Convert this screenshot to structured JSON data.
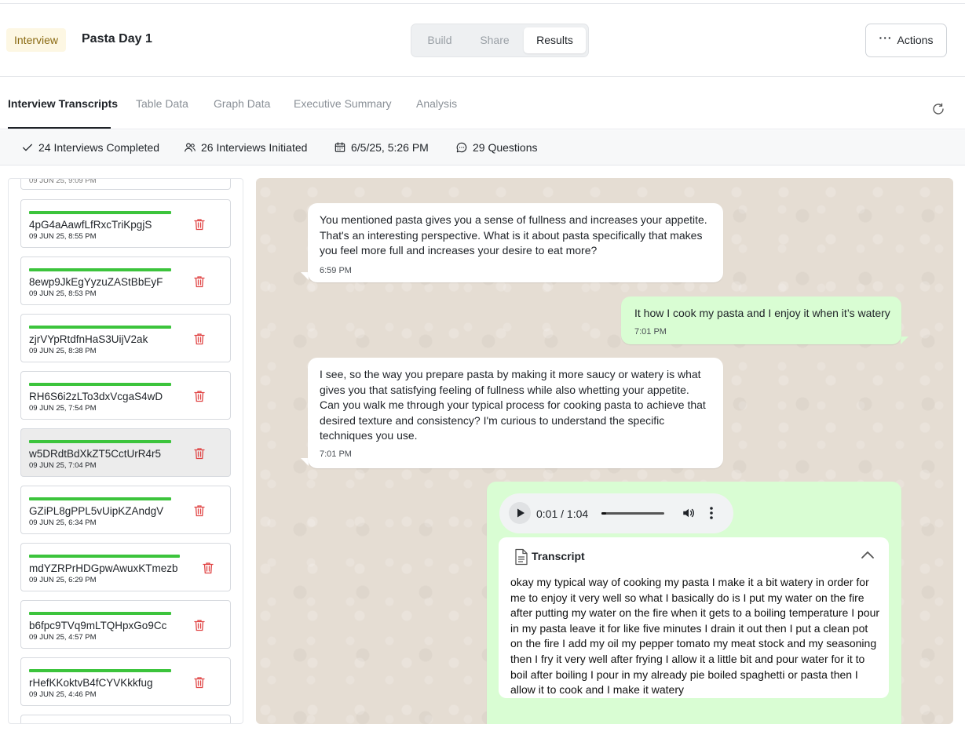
{
  "header": {
    "badge": "Interview",
    "title": "Pasta Day 1",
    "segments": [
      "Build",
      "Share",
      "Results"
    ],
    "active_segment": "Results",
    "actions_label": "Actions"
  },
  "tabs": {
    "items": [
      "Interview Transcripts",
      "Table Data",
      "Graph Data",
      "Executive Summary",
      "Analysis"
    ],
    "active": "Interview Transcripts"
  },
  "stats": {
    "completed": "24 Interviews Completed",
    "initiated": "26 Interviews Initiated",
    "date": "6/5/25, 5:26 PM",
    "questions": "29 Questions"
  },
  "interviews": [
    {
      "id": "4pG4aAawfLfRxcTriKpgjS",
      "time": "09 JUN 25, 8:55 PM",
      "selected": false
    },
    {
      "id": "8ewp9JkEgYyzuZAStBbEyF",
      "time": "09 JUN 25, 8:53 PM",
      "selected": false
    },
    {
      "id": "zjrVYpRtdfnHaS3UijV2ak",
      "time": "09 JUN 25, 8:38 PM",
      "selected": false
    },
    {
      "id": "RH6S6i2zLTo3dxVcgaS4wD",
      "time": "09 JUN 25, 7:54 PM",
      "selected": false
    },
    {
      "id": "w5DRdtBdXkZT5CctUrR4r5",
      "time": "09 JUN 25, 7:04 PM",
      "selected": true
    },
    {
      "id": "GZiPL8gPPL5vUipKZAndgV",
      "time": "09 JUN 25, 6:34 PM",
      "selected": false
    },
    {
      "id": "mdYZRPrHDGpwAwuxKTmezb",
      "time": "09 JUN 25, 6:29 PM",
      "selected": false
    },
    {
      "id": "b6fpc9TVq9mLTQHpxGo9Cc",
      "time": "09 JUN 25, 4:57 PM",
      "selected": false
    },
    {
      "id": "rHefKKoktvB4fCYVKkkfug",
      "time": "09 JUN 25, 4:46 PM",
      "selected": false
    }
  ],
  "messages": [
    {
      "role": "interviewer",
      "text": "You mentioned pasta gives you a sense of fullness and increases your appetite. That's an interesting perspective. What is it about pasta specifically that makes you feel more full and increases your desire to eat more?",
      "time": "6:59 PM"
    },
    {
      "role": "respondent",
      "text": "It how I cook my pasta and I enjoy it when it’s watery",
      "time": "7:01 PM"
    },
    {
      "role": "interviewer",
      "text": "I see, so the way you prepare pasta by making it more saucy or watery is what gives you that satisfying feeling of fullness while also whetting your appetite. Can you walk me through your typical process for cooking pasta to achieve that desired texture and consistency? I'm curious to understand the specific techniques you use.",
      "time": "7:01 PM"
    }
  ],
  "audio": {
    "time_display": "0:01 / 1:04",
    "progress": 0.016
  },
  "transcript": {
    "label": "Transcript",
    "text": " okay my typical way of cooking my pasta I make it a bit watery in order for me to enjoy it very well so what I basically do is I put my water on the fire after putting my water on the fire when it gets to a boiling temperature I pour in my pasta leave it for like five minutes I drain it out then I put a clean pot on the fire I add my oil my pepper tomato my meat stock and my seasoning then I fry it very well after frying I allow it a little bit and pour water for it to boil after boiling I pour in my already pie boiled spaghetti or pasta then I allow it to cook and I make it watery"
  },
  "colors": {
    "progress_green": "#3cc43c",
    "trash_red": "#e04545",
    "bubble_out": "#d9fdd3",
    "chat_bg": "#e5ddd3"
  }
}
